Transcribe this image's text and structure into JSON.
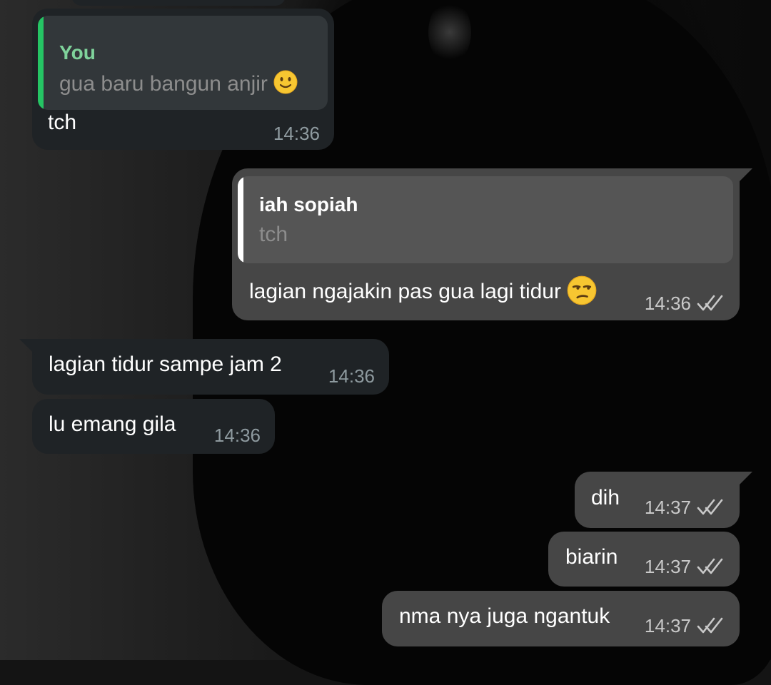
{
  "messages": [
    {
      "direction": "incoming",
      "quote": {
        "author": "You",
        "text": "gua baru bangun anjir",
        "emoji": "slightly-smiling-face"
      },
      "text": "tch",
      "time": "14:36"
    },
    {
      "direction": "outgoing",
      "quote": {
        "author": "iah sopiah",
        "text": "tch"
      },
      "text": "lagian ngajakin pas gua lagi tidur",
      "emoji": "unamused-face",
      "time": "14:36",
      "status_icon": "double-check-icon"
    },
    {
      "direction": "incoming",
      "text": "lagian tidur sampe jam 2",
      "time": "14:36"
    },
    {
      "direction": "incoming",
      "text": "lu emang gila",
      "time": "14:36"
    },
    {
      "direction": "outgoing",
      "text": "dih",
      "time": "14:37",
      "status_icon": "double-check-icon"
    },
    {
      "direction": "outgoing",
      "text": "biarin",
      "time": "14:37",
      "status_icon": "double-check-icon"
    },
    {
      "direction": "outgoing",
      "text": "nma nya juga ngantuk",
      "time": "14:37",
      "status_icon": "double-check-icon"
    }
  ],
  "colors": {
    "incoming_bubble": "#1f2326",
    "outgoing_bubble": "#464646",
    "quote_bar_self": "#25c564",
    "quote_bar_other": "#ffffff",
    "quote_author_self": "#7fd39b"
  }
}
